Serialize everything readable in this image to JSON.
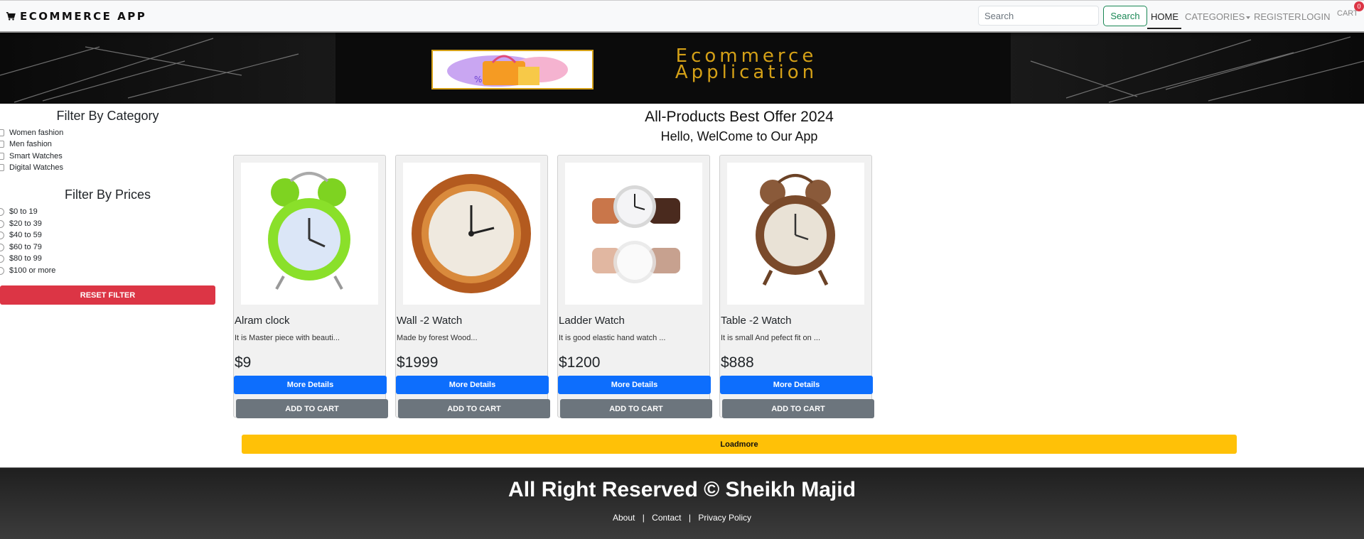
{
  "navbar": {
    "brand": "ECOMMERCE APP",
    "search_placeholder": "Search",
    "search_button": "Search",
    "links": {
      "home": "HOME",
      "categories": "CATEGORIES",
      "register": "REGISTER",
      "login": "LOGIN",
      "cart": "CART"
    },
    "cart_count": "0"
  },
  "banner": {
    "title_line1": "Ecommerce",
    "title_line2": "Application"
  },
  "sidebar": {
    "category_heading": "Filter By Category",
    "categories": [
      "Women fashion",
      "Men fashion",
      "Smart Watches",
      "Digital Watches"
    ],
    "price_heading": "Filter By Prices",
    "prices": [
      "$0 to 19",
      "$20 to 39",
      "$40 to 59",
      "$60 to 79",
      "$80 to 99",
      "$100 or more"
    ],
    "reset_button": "RESET FILTER"
  },
  "main": {
    "title": "All-Products Best Offer 2024",
    "subtitle": "Hello, WelCome to Our App",
    "products": [
      {
        "name": "Alram clock",
        "desc": "It is Master piece with beauti...",
        "price": "$9",
        "details_label": "More Details",
        "cart_label": "ADD TO CART"
      },
      {
        "name": "Wall -2 Watch",
        "desc": "Made by forest Wood...",
        "price": "$1999",
        "details_label": "More Details",
        "cart_label": "ADD TO CART"
      },
      {
        "name": "Ladder Watch",
        "desc": "It is good elastic hand watch ...",
        "price": "$1200",
        "details_label": "More Details",
        "cart_label": "ADD TO CART"
      },
      {
        "name": "Table -2 Watch",
        "desc": "It is small And pefect fit on ...",
        "price": "$888",
        "details_label": "More Details",
        "cart_label": "ADD TO CART"
      }
    ],
    "loadmore": "Loadmore"
  },
  "footer": {
    "text": "All Right Reserved © Sheikh Majid",
    "links": [
      "About",
      "Contact",
      "Privacy Policy"
    ]
  }
}
